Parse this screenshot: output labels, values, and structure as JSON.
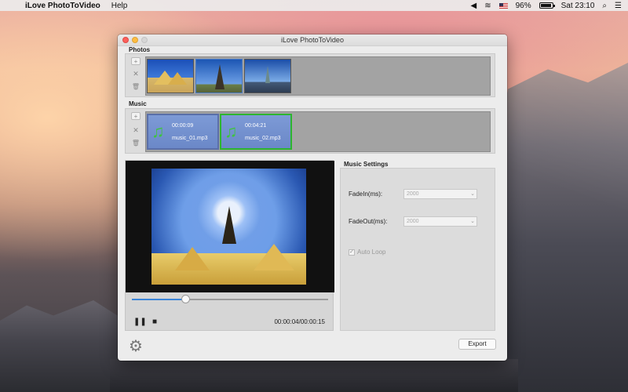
{
  "menubar": {
    "apple_label": "",
    "app_name": "iLove PhotoToVideo",
    "menus": [
      "Help"
    ],
    "battery": "96%",
    "clock": "Sat 23:10"
  },
  "window": {
    "title": "iLove PhotoToVideo"
  },
  "photos": {
    "label": "Photos",
    "add": "+",
    "remove": "✕",
    "trash": "🗑",
    "items": [
      {
        "name": "photo-pyramids"
      },
      {
        "name": "photo-eiffel-tower"
      },
      {
        "name": "photo-statue-of-liberty"
      }
    ]
  },
  "music": {
    "label": "Music",
    "add": "+",
    "remove": "✕",
    "trash": "🗑",
    "items": [
      {
        "duration": "00:00:09",
        "file": "music_01.mp3"
      },
      {
        "duration": "00:04:21",
        "file": "music_02.mp3"
      }
    ]
  },
  "player": {
    "progress": 0.27,
    "pause_icon": "❚❚",
    "stop_icon": "■",
    "time": "00:00:04/00:00:15"
  },
  "music_settings": {
    "title": "Music Settings",
    "fadein_label": "FadeIn(ms):",
    "fadein_value": "2000",
    "fadeout_label": "FadeOut(ms):",
    "fadeout_value": "2000",
    "autoloop_label": "Auto Loop",
    "autoloop_checked": true
  },
  "footer": {
    "settings_icon": "⚙",
    "export_label": "Export"
  }
}
